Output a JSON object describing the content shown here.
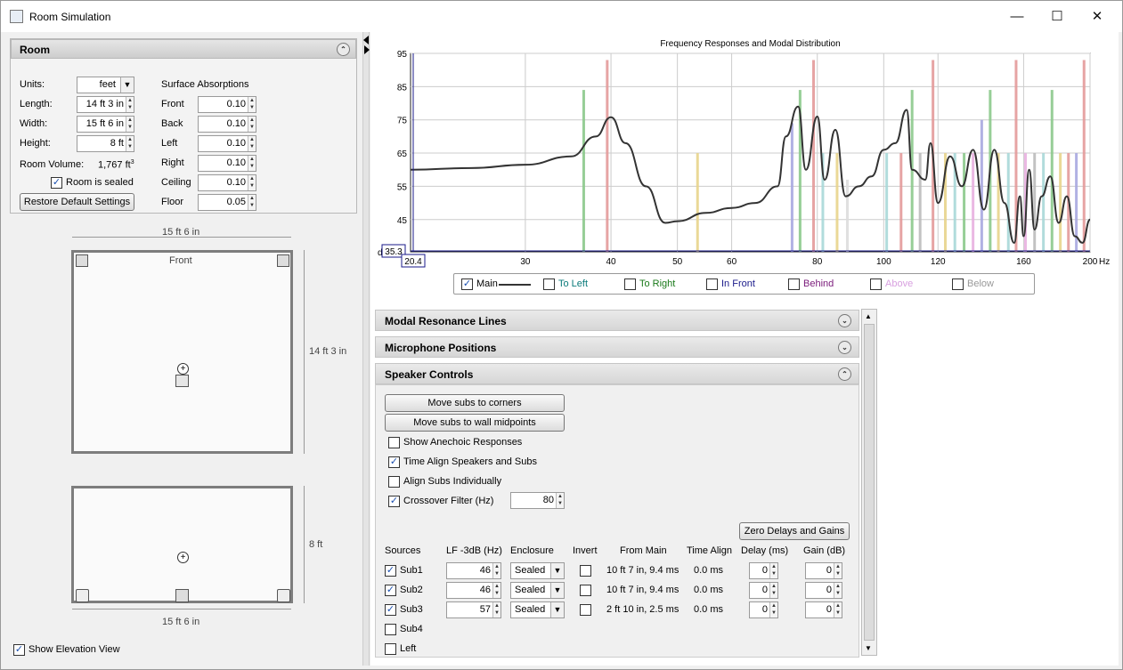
{
  "window": {
    "title": "Room Simulation"
  },
  "room": {
    "header": "Room",
    "units_label": "Units:",
    "units_value": "feet",
    "length_label": "Length:",
    "length_value": "14 ft 3 in",
    "width_label": "Width:",
    "width_value": "15 ft 6 in",
    "height_label": "Height:",
    "height_value": "8 ft",
    "volume_label": "Room Volume:",
    "volume_value": "1,767 ft",
    "volume_unit_exp": "3",
    "sealed_label": "Room is sealed",
    "sealed_checked": true,
    "restore_label": "Restore Default Settings",
    "absorptions_label": "Surface Absorptions",
    "surfaces": [
      {
        "name": "Front",
        "value": "0.10"
      },
      {
        "name": "Back",
        "value": "0.10"
      },
      {
        "name": "Left",
        "value": "0.10"
      },
      {
        "name": "Right",
        "value": "0.10"
      },
      {
        "name": "Ceiling",
        "value": "0.10"
      },
      {
        "name": "Floor",
        "value": "0.05"
      }
    ]
  },
  "plan": {
    "top_dim": "15 ft 6 in",
    "front_label": "Front",
    "side_dim": "14 ft 3 in",
    "elev_side_dim": "8 ft",
    "bottom_dim": "15 ft 6 in"
  },
  "elevation": {
    "label": "Show Elevation View",
    "checked": true
  },
  "chart_data": {
    "type": "bar",
    "title": "Frequency Responses and Modal Distribution",
    "xunit": "Hz",
    "xscale": "log",
    "xlim": [
      20.4,
      200
    ],
    "ylim": [
      35.3,
      95
    ],
    "x_ticks": [
      30,
      40,
      50,
      60,
      80,
      100,
      120,
      160,
      200
    ],
    "y_ticks": [
      45,
      55,
      65,
      75,
      85,
      95
    ],
    "x_readout": "20.4",
    "y_readout": "35.3",
    "y_readout_prefix": "d",
    "main_response": {
      "name": "Main",
      "x": [
        20.4,
        25,
        30,
        35,
        38,
        40,
        42,
        45,
        48,
        50,
        55,
        60,
        65,
        70,
        72,
        75,
        77,
        80,
        82,
        85,
        88,
        92,
        96,
        100,
        104,
        108,
        110,
        115,
        117,
        120,
        125,
        130,
        135,
        140,
        145,
        150,
        155,
        158,
        160,
        163,
        166,
        170,
        175,
        180,
        185,
        190,
        195,
        200
      ],
      "y": [
        60,
        60.5,
        61.5,
        64,
        70,
        75.8,
        68,
        55,
        44,
        44.5,
        47,
        48.5,
        50,
        55,
        70,
        79,
        60,
        76,
        57,
        72,
        52,
        55,
        58,
        66,
        68,
        78,
        60,
        57,
        68,
        50,
        64,
        55,
        66,
        48,
        66,
        50,
        38,
        52,
        40,
        60,
        42,
        52,
        58,
        44,
        52,
        40,
        38,
        45
      ]
    },
    "modal_lines": [
      {
        "x": 36.5,
        "height": 84,
        "color": "#8cc98c"
      },
      {
        "x": 39.5,
        "height": 93,
        "color": "#e39a9a"
      },
      {
        "x": 53.5,
        "height": 65,
        "color": "#e8d48c"
      },
      {
        "x": 73.5,
        "height": 74,
        "color": "#a8a8e0"
      },
      {
        "x": 75.5,
        "height": 84,
        "color": "#8cc98c"
      },
      {
        "x": 79,
        "height": 93,
        "color": "#e39a9a"
      },
      {
        "x": 81.5,
        "height": 65,
        "color": "#a8d8d8"
      },
      {
        "x": 85.5,
        "height": 65,
        "color": "#e8d48c"
      },
      {
        "x": 88.5,
        "height": 57,
        "color": "#ddd"
      },
      {
        "x": 101,
        "height": 65,
        "color": "#a8d8d8"
      },
      {
        "x": 106,
        "height": 65,
        "color": "#e39a9a"
      },
      {
        "x": 110,
        "height": 84,
        "color": "#8cc98c"
      },
      {
        "x": 113,
        "height": 65,
        "color": "#bbb"
      },
      {
        "x": 118,
        "height": 93,
        "color": "#e39a9a"
      },
      {
        "x": 123,
        "height": 65,
        "color": "#e8d48c"
      },
      {
        "x": 127,
        "height": 65,
        "color": "#a8d8d8"
      },
      {
        "x": 131,
        "height": 65,
        "color": "#8cc98c"
      },
      {
        "x": 135,
        "height": 65,
        "color": "#e8b0e0"
      },
      {
        "x": 139,
        "height": 75,
        "color": "#a8a8e0"
      },
      {
        "x": 143,
        "height": 84,
        "color": "#8cc98c"
      },
      {
        "x": 147,
        "height": 65,
        "color": "#e8d48c"
      },
      {
        "x": 152,
        "height": 65,
        "color": "#a8d8d8"
      },
      {
        "x": 156,
        "height": 93,
        "color": "#e39a9a"
      },
      {
        "x": 161,
        "height": 65,
        "color": "#e8b0e0"
      },
      {
        "x": 166,
        "height": 65,
        "color": "#bbb"
      },
      {
        "x": 171,
        "height": 65,
        "color": "#a8d8d8"
      },
      {
        "x": 176,
        "height": 84,
        "color": "#8cc98c"
      },
      {
        "x": 181,
        "height": 65,
        "color": "#e8d48c"
      },
      {
        "x": 186,
        "height": 65,
        "color": "#e39a9a"
      },
      {
        "x": 191,
        "height": 65,
        "color": "#a8a8e0"
      },
      {
        "x": 196,
        "height": 93,
        "color": "#e39a9a"
      }
    ],
    "legend": [
      {
        "label": "Main",
        "checked": true,
        "color": "#000000"
      },
      {
        "label": "To Left",
        "checked": false,
        "color": "#0a7a7a"
      },
      {
        "label": "To Right",
        "checked": false,
        "color": "#1a7a1a"
      },
      {
        "label": "In Front",
        "checked": false,
        "color": "#1a1a8a"
      },
      {
        "label": "Behind",
        "checked": false,
        "color": "#7a1a7a"
      },
      {
        "label": "Above",
        "checked": false,
        "color": "#d8a0e0"
      },
      {
        "label": "Below",
        "checked": false,
        "color": "#999999"
      }
    ]
  },
  "sections": {
    "modal": "Modal Resonance Lines",
    "mic": "Microphone Positions",
    "speaker": "Speaker Controls"
  },
  "speaker": {
    "move_corners": "Move subs to corners",
    "move_mid": "Move subs to wall midpoints",
    "show_anechoic": "Show Anechoic Responses",
    "show_anechoic_checked": false,
    "time_align": "Time Align Speakers and Subs",
    "time_align_checked": true,
    "align_subs": "Align Subs Individually",
    "align_subs_checked": false,
    "crossover": "Crossover Filter (Hz)",
    "crossover_checked": true,
    "crossover_value": "80",
    "zero_btn": "Zero Delays and Gains",
    "headers": {
      "sources": "Sources",
      "lf": "LF -3dB (Hz)",
      "enclosure": "Enclosure",
      "invert": "Invert",
      "from_main": "From Main",
      "time_align": "Time Align",
      "delay": "Delay (ms)",
      "gain": "Gain (dB)"
    },
    "rows": [
      {
        "name": "Sub1",
        "checked": true,
        "lf": "46",
        "enclosure": "Sealed",
        "invert": false,
        "from_main": "10 ft 7 in, 9.4 ms",
        "time_align": "0.0 ms",
        "delay": "0",
        "gain": "0"
      },
      {
        "name": "Sub2",
        "checked": true,
        "lf": "46",
        "enclosure": "Sealed",
        "invert": false,
        "from_main": "10 ft 7 in, 9.4 ms",
        "time_align": "0.0 ms",
        "delay": "0",
        "gain": "0"
      },
      {
        "name": "Sub3",
        "checked": true,
        "lf": "57",
        "enclosure": "Sealed",
        "invert": false,
        "from_main": "2 ft 10 in, 2.5 ms",
        "time_align": "0.0 ms",
        "delay": "0",
        "gain": "0"
      }
    ],
    "extra_rows": [
      {
        "name": "Sub4",
        "checked": false
      },
      {
        "name": "Left",
        "checked": false
      }
    ]
  }
}
